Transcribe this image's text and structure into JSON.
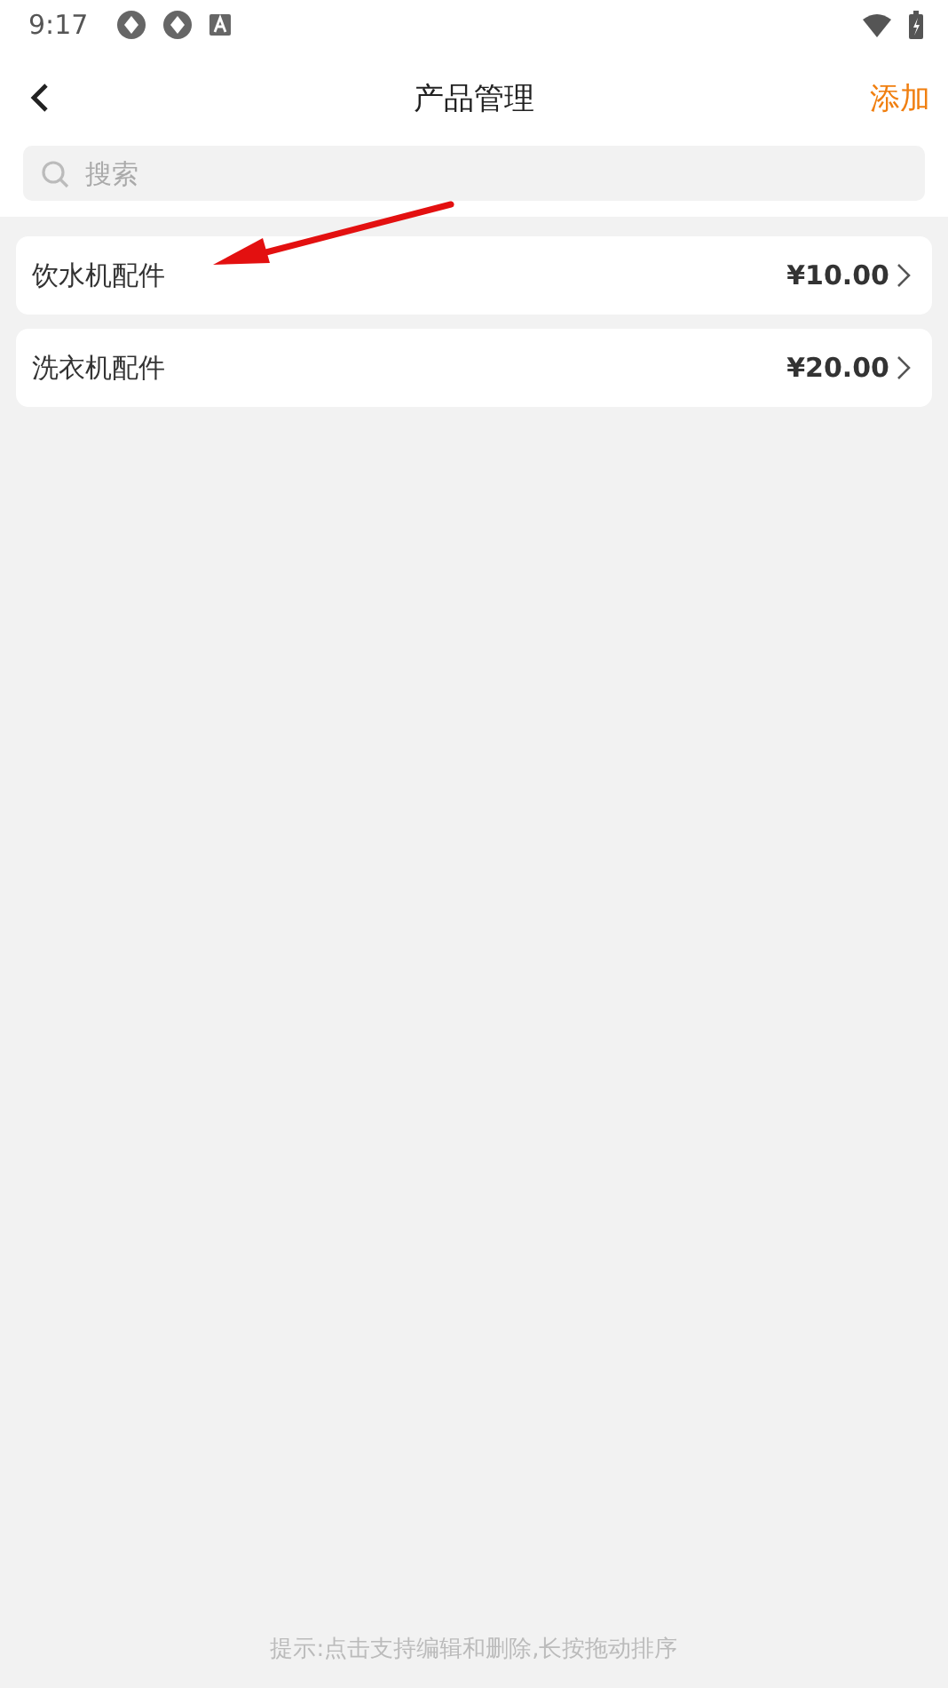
{
  "status_bar": {
    "time": "9:17"
  },
  "header": {
    "title": "产品管理",
    "action": "添加"
  },
  "search": {
    "placeholder": "搜索"
  },
  "products": [
    {
      "name": "饮水机配件",
      "price": "¥10.00"
    },
    {
      "name": "洗衣机配件",
      "price": "¥20.00"
    }
  ],
  "annotation": {
    "kind": "arrow"
  },
  "hint": "提示:点击支持编辑和删除,长按拖动排序"
}
